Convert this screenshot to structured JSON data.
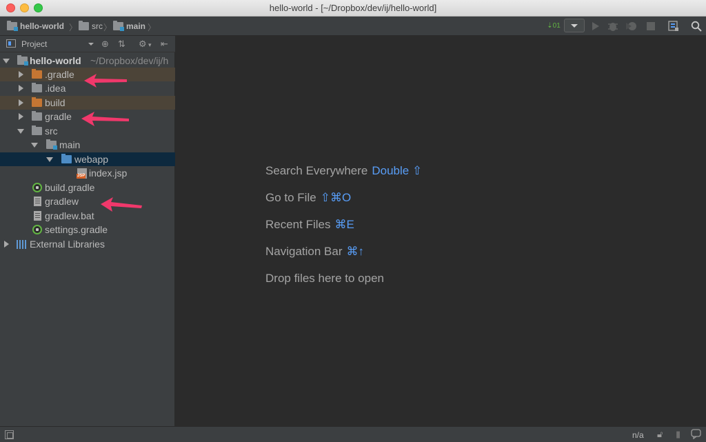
{
  "window": {
    "title": "hello-world - [~/Dropbox/dev/ij/hello-world]"
  },
  "breadcrumbs": [
    {
      "label": "hello-world",
      "icon": "module-folder-icon"
    },
    {
      "label": "src",
      "icon": "folder-icon"
    },
    {
      "label": "main",
      "icon": "module-folder-icon"
    }
  ],
  "toolbar": {
    "icons": [
      "build-icon",
      "run-configuration-dropdown",
      "run-icon",
      "debug-icon",
      "coverage-icon",
      "stop-icon",
      "project-structure-icon",
      "search-icon"
    ]
  },
  "project_panel": {
    "title": "Project",
    "header_icons": [
      "locate-icon",
      "collapse-all-icon",
      "gear-icon",
      "hide-panel-icon"
    ]
  },
  "tree": [
    {
      "label": "hello-world",
      "hint": "~/Dropbox/dev/ij/h",
      "level": 0,
      "expanded": true,
      "icon": "module-folder-icon",
      "bold": true
    },
    {
      "label": ".gradle",
      "level": 1,
      "expanded": false,
      "icon": "excluded-folder-icon",
      "excluded": true
    },
    {
      "label": ".idea",
      "level": 1,
      "expanded": false,
      "icon": "folder-icon"
    },
    {
      "label": "build",
      "level": 1,
      "expanded": false,
      "icon": "excluded-folder-icon",
      "excluded": true
    },
    {
      "label": "gradle",
      "level": 1,
      "expanded": false,
      "icon": "folder-icon"
    },
    {
      "label": "src",
      "level": 1,
      "expanded": true,
      "icon": "folder-icon"
    },
    {
      "label": "main",
      "level": 2,
      "expanded": true,
      "icon": "module-folder-icon"
    },
    {
      "label": "webapp",
      "level": 3,
      "expanded": true,
      "icon": "web-folder-icon",
      "selected": true
    },
    {
      "label": "index.jsp",
      "level": 4,
      "icon": "jsp-file-icon"
    },
    {
      "label": "build.gradle",
      "level": 1,
      "icon": "gradle-file-icon"
    },
    {
      "label": "gradlew",
      "level": 1,
      "icon": "text-file-icon"
    },
    {
      "label": "gradlew.bat",
      "level": 1,
      "icon": "text-file-icon"
    },
    {
      "label": "settings.gradle",
      "level": 1,
      "icon": "gradle-file-icon"
    },
    {
      "label": "External Libraries",
      "level": 0,
      "expanded": false,
      "icon": "library-icon"
    }
  ],
  "editor_hints": [
    {
      "text": "Search Everywhere",
      "shortcut": "Double ⇧"
    },
    {
      "text": "Go to File",
      "shortcut": "⇧⌘O"
    },
    {
      "text": "Recent Files",
      "shortcut": "⌘E"
    },
    {
      "text": "Navigation Bar",
      "shortcut": "⌘↑"
    },
    {
      "text": "Drop files here to open",
      "shortcut": ""
    }
  ],
  "status_bar": {
    "position": "n/a",
    "icons": [
      "tool-windows-toggle-icon",
      "lock-icon",
      "inspector-icon",
      "event-log-icon"
    ]
  },
  "colors": {
    "accent": "#589df6",
    "annotation_arrow": "#f0386b",
    "excluded_folder": "#c57633",
    "selection": "#0d293e"
  }
}
